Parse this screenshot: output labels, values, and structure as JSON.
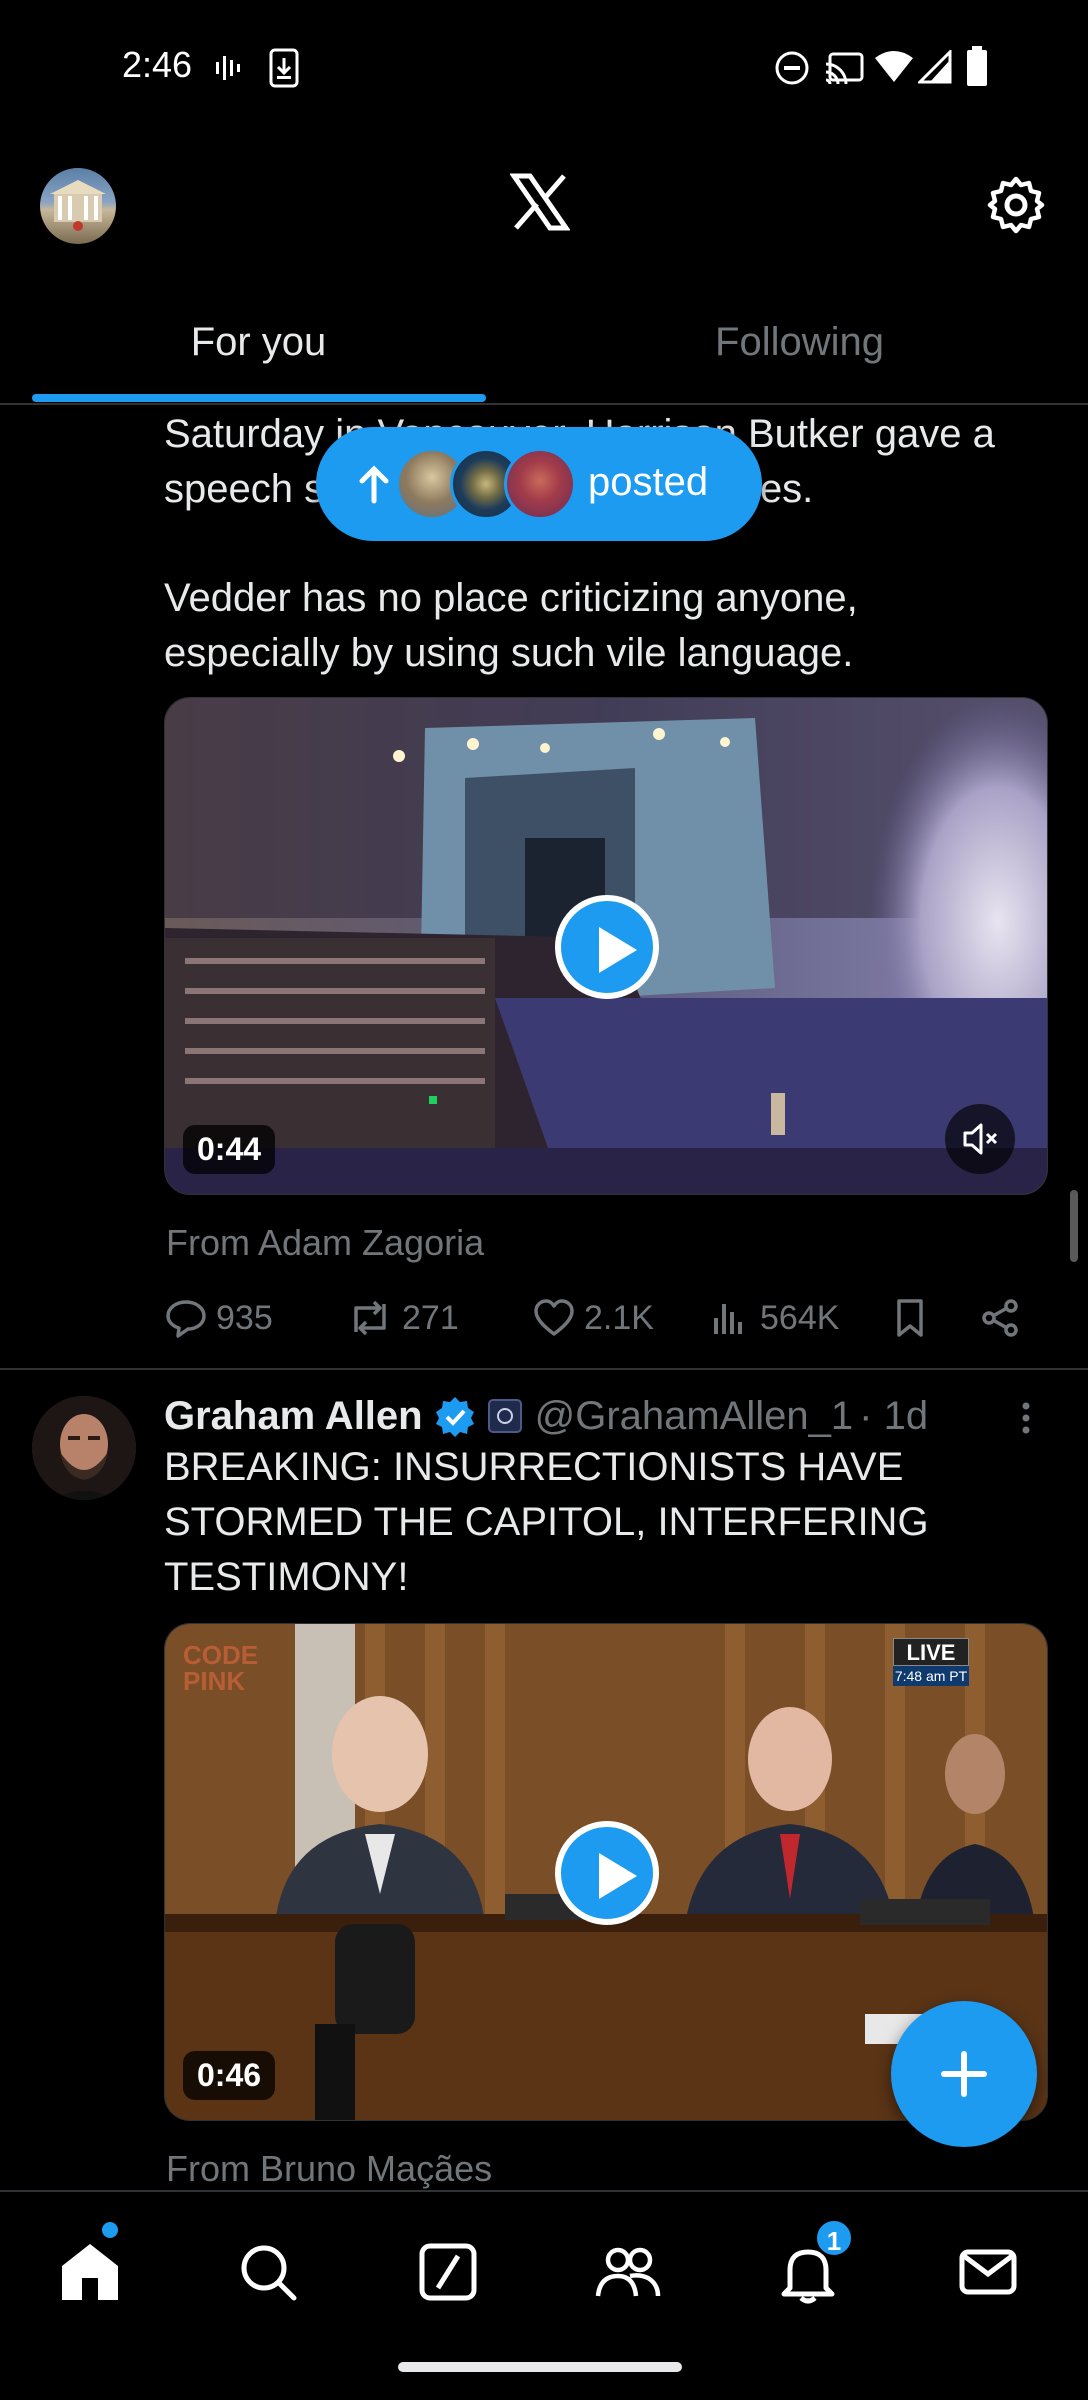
{
  "status_bar": {
    "time": "2:46"
  },
  "tabs": [
    {
      "label": "For you",
      "active": true
    },
    {
      "label": "Following",
      "active": false
    }
  ],
  "new_posts_pill": {
    "label": "posted"
  },
  "tweet1": {
    "text_line1": "Saturday in Vancouver. Harrison Butker gave a",
    "text_line2": "speech supporting traditional values.",
    "text_line3": "Vedder has no place criticizing anyone,",
    "text_line4": "especially by using such vile language.",
    "video_duration": "0:44",
    "from": "From Adam Zagoria",
    "replies": "935",
    "reposts": "271",
    "likes": "2.1K",
    "views": "564K"
  },
  "tweet2": {
    "name": "Graham Allen",
    "handle": "@GrahamAllen_1",
    "time": "· 1d",
    "text_line1": "BREAKING: INSURRECTIONISTS HAVE",
    "text_line2": "STORMED THE CAPITOL, INTERFERING",
    "text_line3": "TESTIMONY!",
    "video_duration": "0:46",
    "video_live_label": "LIVE",
    "video_live_time": "7:48 am PT",
    "video_watermark": "CODE PINK",
    "from": "From Bruno Maçães"
  },
  "bottom_nav": {
    "items": [
      "home-icon",
      "search-icon",
      "grok-icon",
      "communities-icon",
      "notifications-icon",
      "messages-icon"
    ],
    "notification_count": "1"
  },
  "colors": {
    "accent": "#1d9bf0",
    "background": "#000000",
    "secondary_text": "#71767b"
  }
}
